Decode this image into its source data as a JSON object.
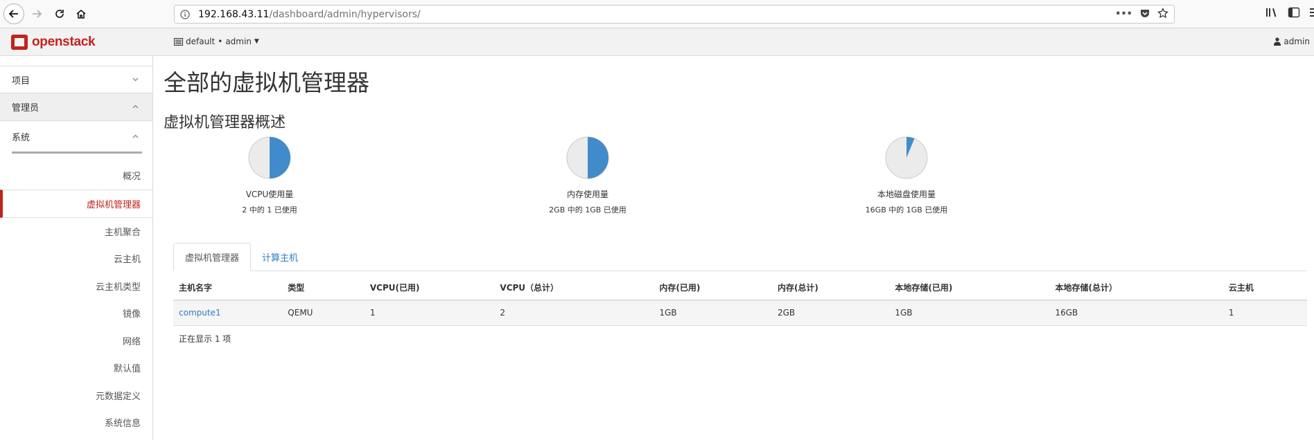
{
  "browser": {
    "url_host": "192.168.43.11",
    "url_path": "/dashboard/admin/hypervisors/",
    "page_actions_label": "•••"
  },
  "topnav": {
    "logo_text": "openstack",
    "project_domain": "default",
    "project_separator": "•",
    "project_name": "admin",
    "user_name": "admin",
    "brand_color": "#c2231d"
  },
  "sidebar": {
    "project_label": "项目",
    "admin_label": "管理员",
    "system_label": "系统",
    "items": [
      {
        "label": "概况",
        "active": false
      },
      {
        "label": "虚拟机管理器",
        "active": true
      },
      {
        "label": "主机聚合",
        "active": false
      },
      {
        "label": "云主机",
        "active": false
      },
      {
        "label": "云主机类型",
        "active": false
      },
      {
        "label": "镜像",
        "active": false
      },
      {
        "label": "网络",
        "active": false
      },
      {
        "label": "默认值",
        "active": false
      },
      {
        "label": "元数据定义",
        "active": false
      },
      {
        "label": "系统信息",
        "active": false
      }
    ]
  },
  "main": {
    "page_title": "全部的虚拟机管理器",
    "section_title": "虚拟机管理器概述",
    "usage": [
      {
        "label": "VCPU使用量",
        "sub": "2 中的 1 已使用",
        "used": 1,
        "total": 2
      },
      {
        "label": "内存使用量",
        "sub": "2GB 中的 1GB 已使用",
        "used": 1,
        "total": 2
      },
      {
        "label": "本地磁盘使用量",
        "sub": "16GB 中的 1GB 已使用",
        "used": 1,
        "total": 16
      }
    ],
    "pie_colors": {
      "used": "#428bca",
      "free": "#ebebeb",
      "stroke": "#cccccc"
    },
    "tabs": [
      {
        "label": "虚拟机管理器",
        "active": true
      },
      {
        "label": "计算主机",
        "active": false
      }
    ],
    "table": {
      "columns": [
        "主机名字",
        "类型",
        "VCPU(已用)",
        "VCPU（总计）",
        "内存(已用)",
        "内存(总计)",
        "本地存储(已用)",
        "本地存储(总计）",
        "云主机"
      ],
      "rows": [
        [
          "compute1",
          "QEMU",
          "1",
          "2",
          "1GB",
          "2GB",
          "1GB",
          "16GB",
          "1"
        ]
      ]
    },
    "row_count": "正在显示 1 项"
  }
}
